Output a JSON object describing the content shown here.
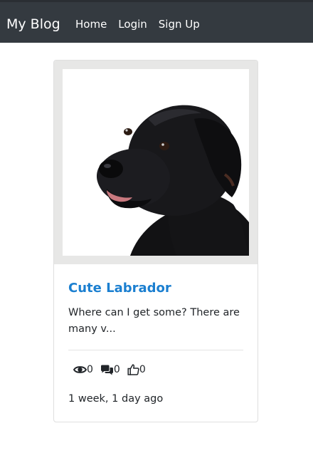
{
  "navbar": {
    "brand": "My Blog",
    "links": [
      "Home",
      "Login",
      "Sign Up"
    ]
  },
  "post": {
    "image_subject": "black labrador dog portrait",
    "title": "Cute Labrador",
    "excerpt": "Where can I get some? There are many v...",
    "views": "0",
    "comments": "0",
    "likes": "0",
    "time_ago": "1 week, 1 day ago",
    "icons": [
      "eye-icon",
      "comments-icon",
      "thumbs-up-icon"
    ]
  },
  "colors": {
    "navbar_bg": "#343a40",
    "title_link": "#1b7fd0",
    "text": "#212529"
  }
}
